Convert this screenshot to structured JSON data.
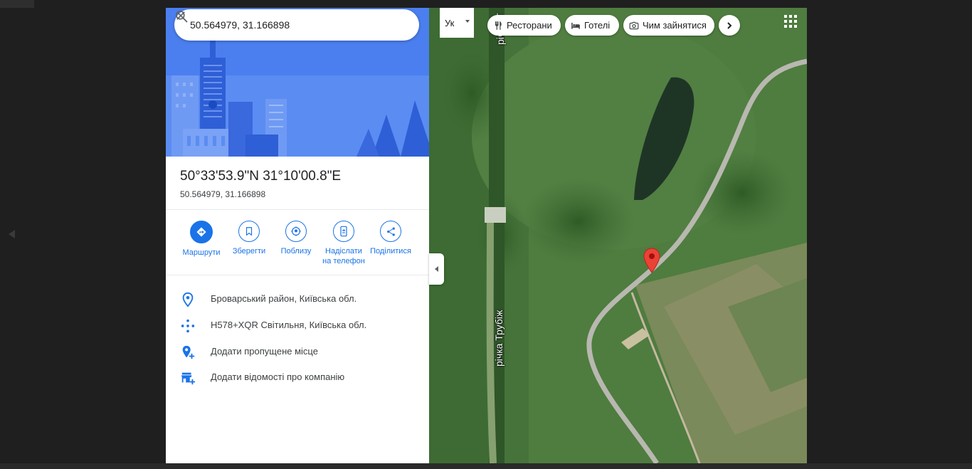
{
  "search": {
    "value": "50.564979, 31.166898",
    "placeholder": ""
  },
  "place": {
    "title": "50°33'53.9\"N 31°10'00.8\"E",
    "subtitle": "50.564979, 31.166898"
  },
  "actions": [
    {
      "label": "Маршрути",
      "icon": "directions-icon"
    },
    {
      "label": "Зберегти",
      "icon": "bookmark-icon"
    },
    {
      "label": "Поблизу",
      "icon": "nearby-icon"
    },
    {
      "label_line1": "Надіслати",
      "label_line2": "на телефон",
      "icon": "send-to-phone-icon"
    },
    {
      "label": "Поділитися",
      "icon": "share-icon"
    }
  ],
  "info": [
    {
      "text": "Броварський район, Київська обл.",
      "icon": "location-pin-icon"
    },
    {
      "text": "H578+XQR Світильня, Київська обл.",
      "icon": "plus-code-icon"
    },
    {
      "text": "Додати пропущене місце",
      "icon": "add-place-icon"
    },
    {
      "text": "Додати відомості про компанію",
      "icon": "add-business-icon"
    }
  ],
  "map": {
    "lang": "Ук",
    "chips": [
      {
        "label": "Ресторани",
        "icon": "restaurant-icon"
      },
      {
        "label": "Готелі",
        "icon": "hotel-icon"
      },
      {
        "label": "Чим зайнятися",
        "icon": "camera-icon"
      }
    ],
    "river_label": "річка Трубіж",
    "river_label_top": "річка Т"
  },
  "colors": {
    "accent": "#1a73e8",
    "pin": "#ea4335",
    "hero": "#4b7ff0"
  }
}
